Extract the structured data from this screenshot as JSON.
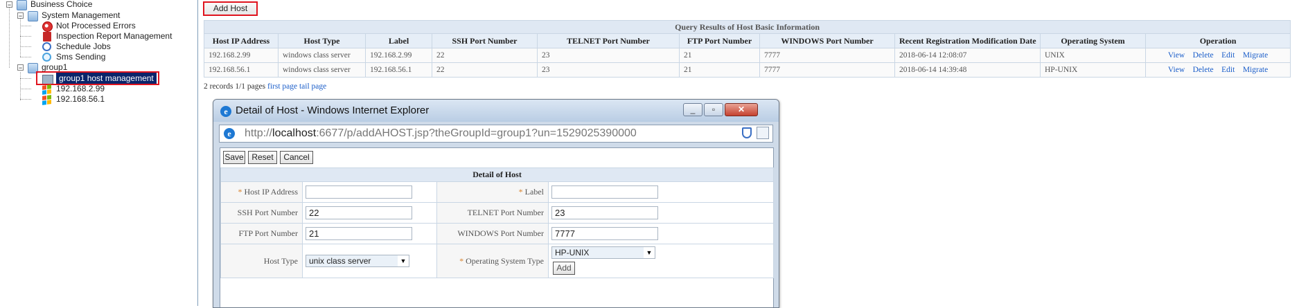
{
  "tree": {
    "root": "Business Choice",
    "system_management": "System Management",
    "not_processed_errors": "Not Processed Errors",
    "inspection_report": "Inspection Report Management",
    "schedule_jobs": "Schedule Jobs",
    "sms_sending": "Sms Sending",
    "group1": "group1",
    "group1_host_mgmt": "group1 host management",
    "host1": "192.168.2.99",
    "host2": "192.168.56.1"
  },
  "toolbar": {
    "add_host": "Add Host"
  },
  "results": {
    "caption": "Query Results of Host Basic Information",
    "headers": [
      "Host IP Address",
      "Host Type",
      "Label",
      "SSH Port Number",
      "TELNET Port Number",
      "FTP Port Number",
      "WINDOWS Port Number",
      "Recent Registration Modification Date",
      "Operating System",
      "Operation"
    ],
    "rows": [
      [
        "192.168.2.99",
        "windows class server",
        "192.168.2.99",
        "22",
        "23",
        "21",
        "7777",
        "2018-06-14 12:08:07",
        "UNIX"
      ],
      [
        "192.168.56.1",
        "windows class server",
        "192.168.56.1",
        "22",
        "23",
        "21",
        "7777",
        "2018-06-14 14:39:48",
        "HP-UNIX"
      ]
    ],
    "ops": [
      "View",
      "Delete",
      "Edit",
      "Migrate"
    ]
  },
  "pager": {
    "summary": "2 records 1/1 pages",
    "first": "first page",
    "tail": "tail page"
  },
  "dialog": {
    "title": "Detail of Host - Windows Internet Explorer",
    "url_prefix": "http://",
    "url_host": "localhost",
    "url_rest": ":6677/p/addAHOST.jsp?theGroupId=group1?un=1529025390000",
    "save": "Save",
    "reset": "Reset",
    "cancel": "Cancel",
    "caption": "Detail of Host",
    "required_mark": "*",
    "host_ip_label": "Host IP Address",
    "host_ip_value": "",
    "label_label": "Label",
    "label_value": "",
    "ssh_label": "SSH Port Number",
    "ssh_value": "22",
    "telnet_label": "TELNET Port Number",
    "telnet_value": "23",
    "ftp_label": "FTP Port Number",
    "ftp_value": "21",
    "windows_label": "WINDOWS Port Number",
    "windows_value": "7777",
    "host_type_label": "Host Type",
    "host_type_value": "unix class server",
    "os_type_label": "Operating System Type",
    "os_type_value": "HP-UNIX",
    "add": "Add"
  }
}
